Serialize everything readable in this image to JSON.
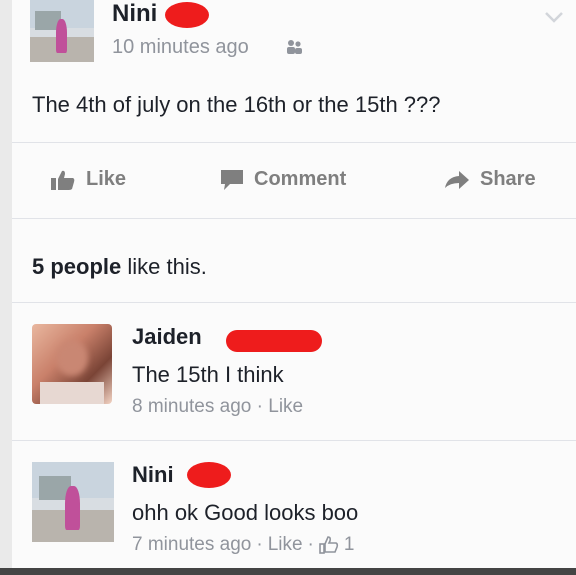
{
  "post": {
    "author": "Nini",
    "time": "10 minutes ago",
    "audience_icon": "friends-icon",
    "text": "The 4th of july on the 16th or the 15th ???"
  },
  "actions": {
    "like": "Like",
    "comment": "Comment",
    "share": "Share"
  },
  "likes_summary": {
    "count": "5 people",
    "suffix": " like this."
  },
  "comments": [
    {
      "author": "Jaiden",
      "text": "The 15th I think",
      "time": "8 minutes ago",
      "sep": "·",
      "like": "Like"
    },
    {
      "author": "Nini",
      "text": "ohh ok Good looks boo",
      "time": "7 minutes ago",
      "sep": "·",
      "like": "Like",
      "sep2": "·",
      "like_count": "1"
    }
  ],
  "colors": {
    "redaction": "#ee1c1c",
    "text": "#1d2129",
    "meta": "#90949c",
    "action": "#7f7f7f"
  }
}
